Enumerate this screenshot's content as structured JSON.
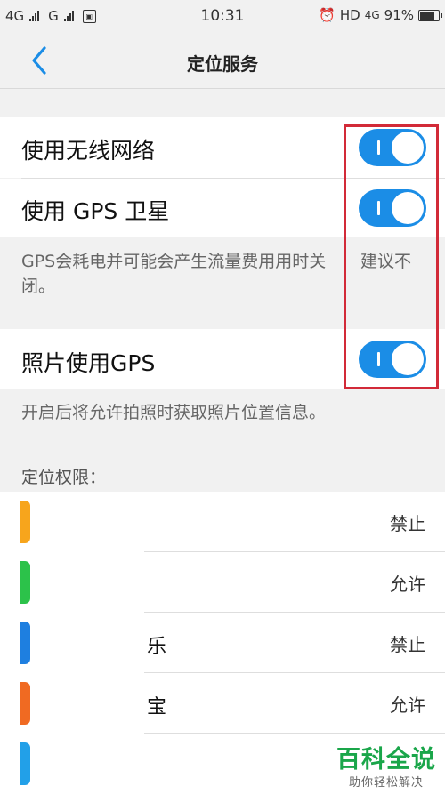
{
  "status_bar": {
    "network_1": "4G",
    "network_2": "G",
    "time": "10:31",
    "hd": "HD",
    "network_3": "4G",
    "battery_percent": "91%",
    "battery_level": 0.91
  },
  "nav": {
    "title": "定位服务"
  },
  "settings": {
    "wireless": {
      "label": "使用无线网络",
      "enabled": true
    },
    "gps": {
      "label": "使用 GPS 卫星",
      "enabled": true
    },
    "gps_note_left": "GPS会耗电并可能会产生流量费用用时关闭。",
    "gps_note_right": "建议不",
    "photo_gps": {
      "label": "照片使用GPS",
      "enabled": true
    },
    "photo_note": "开启后将允许拍照时获取照片位置信息。"
  },
  "permissions": {
    "title": "定位权限：",
    "apps": [
      {
        "name": "",
        "permission": "禁止",
        "icon_color": "#f7a51c"
      },
      {
        "name": "",
        "permission": "允许",
        "icon_color": "#2cc24a"
      },
      {
        "name": "乐",
        "permission": "禁止",
        "icon_color": "#1e7fe0"
      },
      {
        "name": "宝",
        "permission": "允许",
        "icon_color": "#f06a22"
      },
      {
        "name": "",
        "permission": "",
        "icon_color": "#22a0e8"
      }
    ]
  },
  "colors": {
    "accent": "#1b8de6",
    "highlight_box": "#d22a38",
    "watermark": "#1aa64a"
  },
  "watermark": {
    "title": "百科全说",
    "subtitle": "助你轻松解决"
  }
}
